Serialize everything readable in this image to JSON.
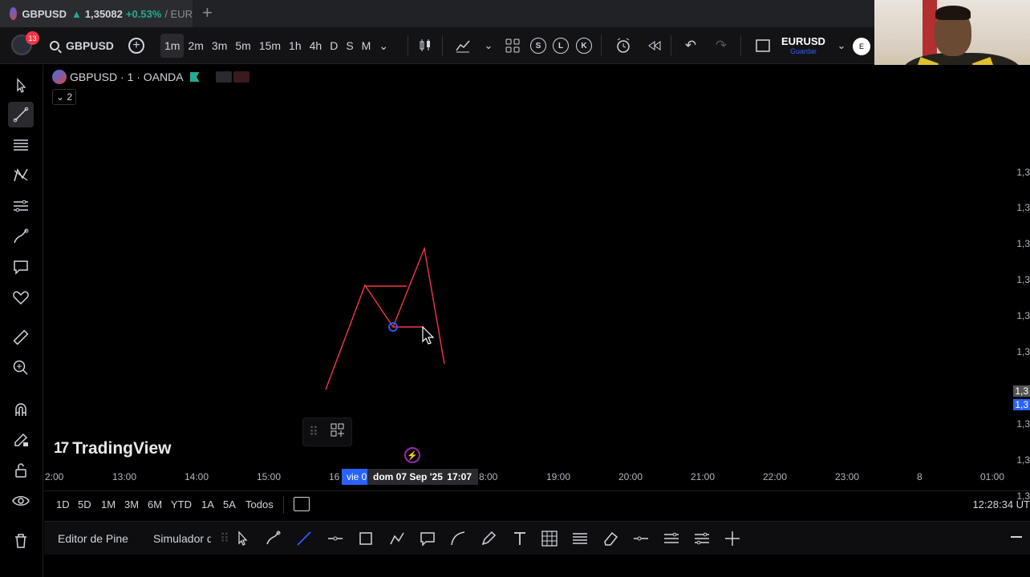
{
  "browser_tab": {
    "title_symbol": "GBPUSD",
    "arrow": "▲",
    "price": "1,35082",
    "change": "+0.53%",
    "rest": "/ EUR"
  },
  "toolbar": {
    "notifications": "13",
    "symbol": "GBPUSD",
    "intervals": [
      "1m",
      "2m",
      "3m",
      "5m",
      "15m",
      "1h",
      "4h",
      "D",
      "S",
      "M"
    ],
    "active_interval": "1m",
    "letter_buttons": [
      "S",
      "L",
      "K"
    ],
    "layout_name": "EURUSD",
    "layout_status": "Guardar",
    "user_initial": "E"
  },
  "chart": {
    "legend_title": "GBPUSD · 1 · OANDA",
    "collapse_label": "⌄ 2",
    "watermark": "TradingView",
    "drawing_color": "#f23645",
    "price_ticks": [
      "1,3",
      "1,3",
      "1,3",
      "1,3",
      "1,3",
      "1,3",
      "1,3",
      "1,3",
      "1,3",
      "1,3",
      "1,3"
    ],
    "time_ticks": [
      "2:00",
      "13:00",
      "14:00",
      "15:00",
      "16",
      "8:00",
      "19:00",
      "20:00",
      "21:00",
      "22:00",
      "23:00",
      "8",
      "01:00"
    ],
    "time_selection": "vie 0",
    "crosshair_date": "dom 07 Sep '25",
    "crosshair_time": "17:07"
  },
  "range_bar": {
    "ranges": [
      "1D",
      "5D",
      "1M",
      "3M",
      "6M",
      "YTD",
      "1A",
      "5A",
      "Todos"
    ],
    "clock": "12:28:34 UT"
  },
  "bottom_panel": {
    "tabs": [
      "Editor de Pine",
      "Simulador d"
    ]
  },
  "icons": {
    "left_tools": [
      "cursor-icon",
      "trendline-icon",
      "fib-icon",
      "pattern-icon",
      "projection-icon",
      "brush-icon",
      "text-note-icon",
      "heart-icon",
      "ruler-icon",
      "zoom-icon",
      "magnet-icon",
      "lock-pencil-icon",
      "lock-icon",
      "eye-icon",
      "trash-icon"
    ]
  }
}
